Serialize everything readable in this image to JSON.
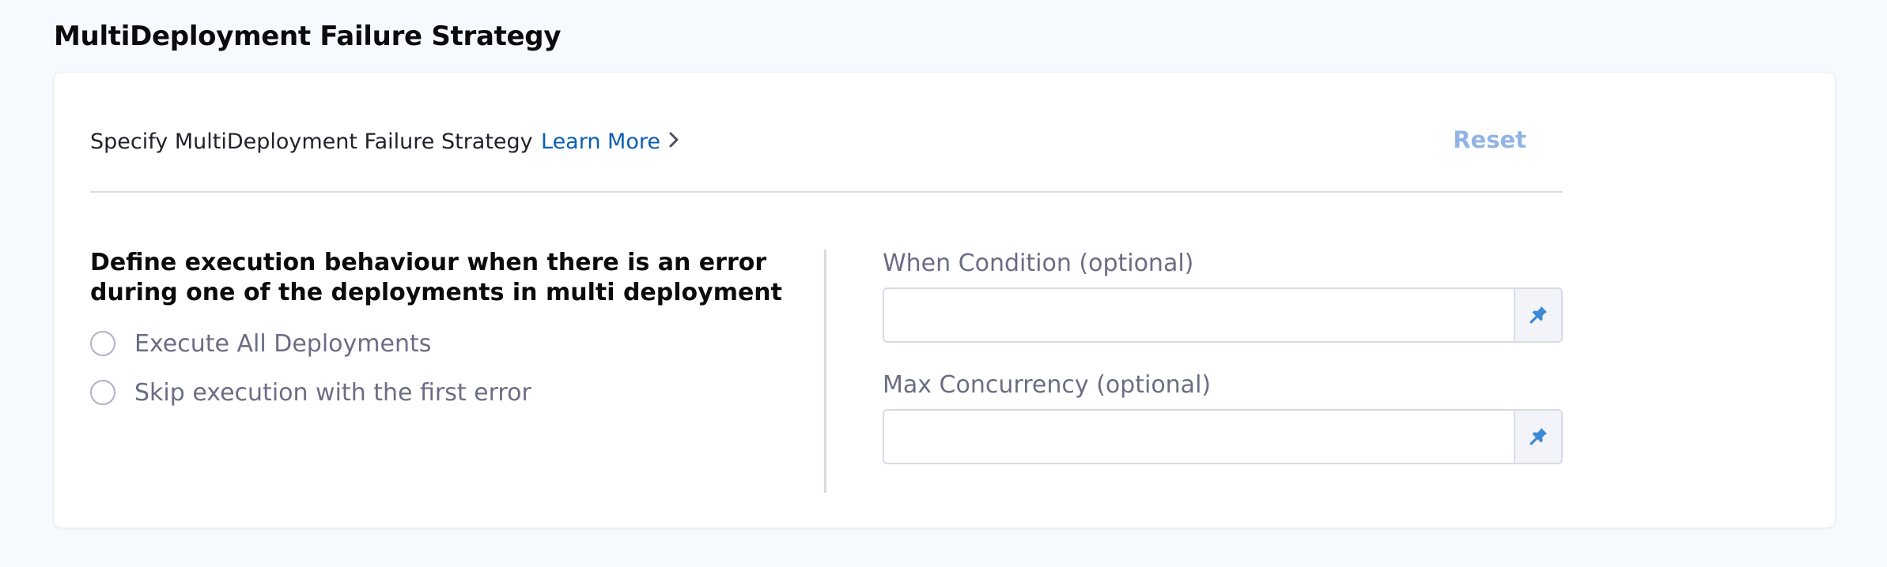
{
  "page_title": "MultiDeployment Failure Strategy",
  "header": {
    "specify_text": "Specify MultiDeployment Failure Strategy",
    "learn_more_label": "Learn More",
    "reset_label": "Reset"
  },
  "execution": {
    "question": "Define execution behaviour when there is an error during one of the deployments in multi deployment",
    "options": [
      {
        "label": "Execute All Deployments",
        "selected": false
      },
      {
        "label": "Skip execution with the first error",
        "selected": false
      }
    ]
  },
  "fields": {
    "when_condition": {
      "label": "When Condition (optional)",
      "value": "",
      "icon": "pin-icon"
    },
    "max_concurrency": {
      "label": "Max Concurrency (optional)",
      "value": "",
      "icon": "pin-icon"
    }
  },
  "colors": {
    "link": "#0a5fb4",
    "reset": "#92b4e4",
    "pin": "#3d8ad4",
    "muted_text": "#6b6d85",
    "border": "#d9dae5"
  }
}
